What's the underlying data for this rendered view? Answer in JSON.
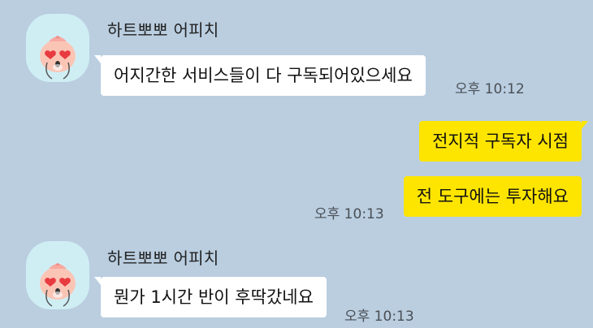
{
  "messages": [
    {
      "type": "incoming",
      "sender": "하트뽀뽀 어피치",
      "avatar_icon": "apeach-heart-eyes-avatar-icon",
      "text": "어지간한 서비스들이 다 구독되어있으세요",
      "time": "오후 10:12"
    },
    {
      "type": "outgoing",
      "text": "전지적 구독자 시점",
      "time": ""
    },
    {
      "type": "outgoing",
      "text": "전 도구에는 투자해요",
      "time": "오후 10:13"
    },
    {
      "type": "incoming",
      "sender": "하트뽀뽀 어피치",
      "avatar_icon": "apeach-heart-eyes-avatar-icon",
      "text": "뭔가 1시간 반이 후딱갔네요",
      "time": "오후 10:13"
    }
  ],
  "colors": {
    "background": "#bacee0",
    "incoming_bubble": "#ffffff",
    "outgoing_bubble": "#fee500",
    "avatar_bg": "#cfeef4"
  }
}
